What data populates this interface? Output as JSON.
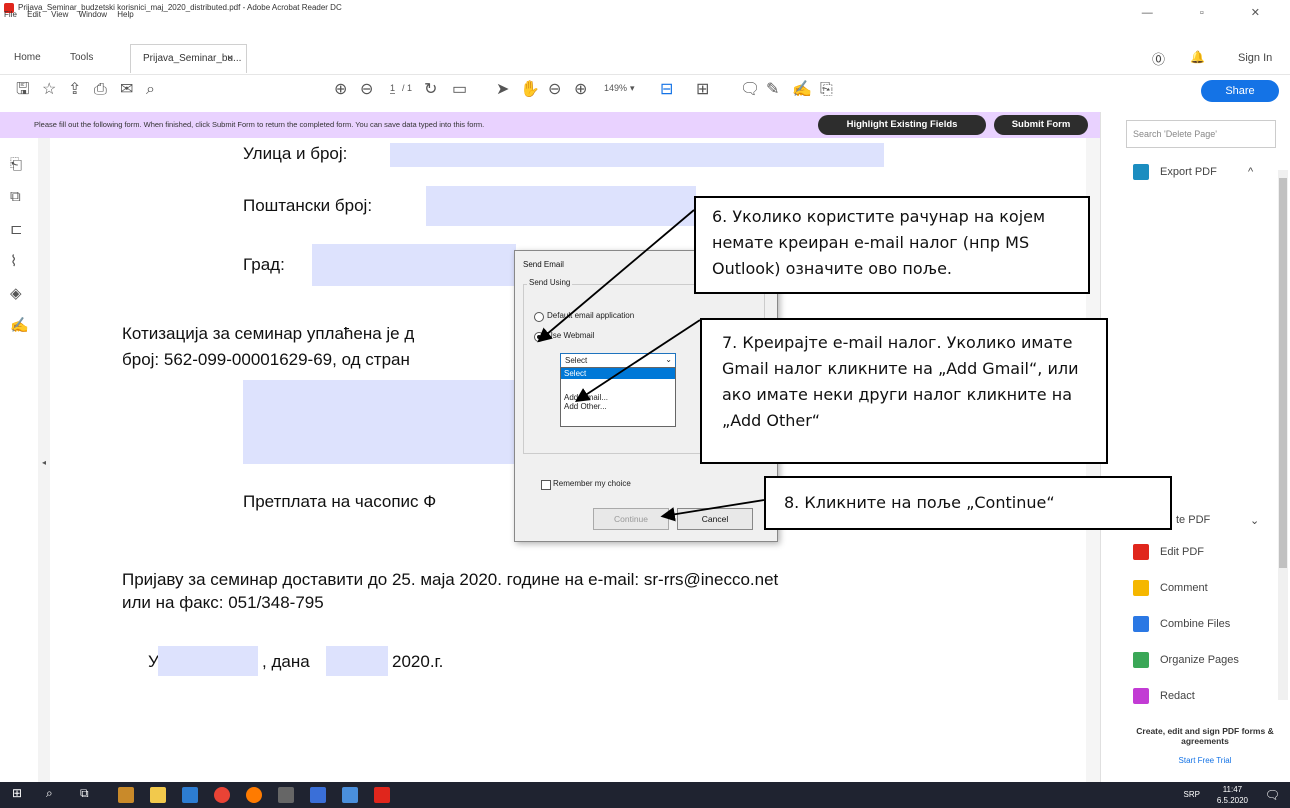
{
  "window": {
    "title": "Prijava_Seminar_budzetski korisnici_maj_2020_distributed.pdf - Adobe Acrobat Reader DC"
  },
  "menu": [
    "File",
    "Edit",
    "View",
    "Window",
    "Help"
  ],
  "tabs": {
    "home": "Home",
    "tools": "Tools",
    "doc": "Prijava_Seminar_bu...",
    "close": "×"
  },
  "header_right": {
    "signin": "Sign In"
  },
  "toolbar": {
    "page_current": "1",
    "page_total": "/ 1",
    "zoom": "149%",
    "share": "Share"
  },
  "formbar": {
    "message": "Please fill out the following form. When finished, click Submit Form to return the completed form. You can save data typed into this form.",
    "highlight": "Highlight Existing Fields",
    "submit": "Submit Form"
  },
  "document": {
    "street": "Улица и број:",
    "postal": "Поштански број:",
    "city": "Град:",
    "fee_line1": "Котизација за семинар уплаћена је д",
    "fee_line2": "број: 562-099-00001629-69, од стран",
    "subscription": "Претплата на часопис Ф",
    "deliver_line1": "Пријаву за семинар доставити до 25. маја 2020. године на e-mail: sr-rrs@inecco.net",
    "deliver_line2": "или на факс: 051/348-795",
    "place_prefix": "У",
    "date_mid": ", дана",
    "year": "2020.г."
  },
  "dialog": {
    "title": "Send Email",
    "group": "Send Using",
    "option_default": "Default email application",
    "option_webmail": "Use Webmail",
    "select_value": "Select",
    "list": [
      "Select",
      "Add Gmail...",
      "Add Other..."
    ],
    "remember": "Remember my choice",
    "continue": "Continue",
    "cancel": "Cancel"
  },
  "callouts": {
    "c6": "6.  Уколико користите рачунар на којем немате креиран e-mail налог (нпр MS Outlook) означите ово поље.",
    "c7": "7.  Креирајте e-mail налог. Уколико имате Gmail налог кликните на „Add Gmail“, или ако имате неки други налог кликните на „Add Other“",
    "c8": "8.  Кликните на поље „Continue“"
  },
  "rightpane": {
    "search_placeholder": "Search 'Delete Page'",
    "export": "Export PDF",
    "create": "te PDF",
    "edit": "Edit PDF",
    "comment": "Comment",
    "combine": "Combine Files",
    "organize": "Organize Pages",
    "redact": "Redact",
    "promo": "Create, edit and sign PDF forms & agreements",
    "trial": "Start Free Trial"
  },
  "taskbar": {
    "lang": "SRP",
    "time": "11:47",
    "date": "6.5.2020"
  },
  "colors": {
    "accent": "#1473e6",
    "formbar": "#e9d2ff",
    "field": "#dde2fd",
    "taskbar": "#1f2330"
  }
}
